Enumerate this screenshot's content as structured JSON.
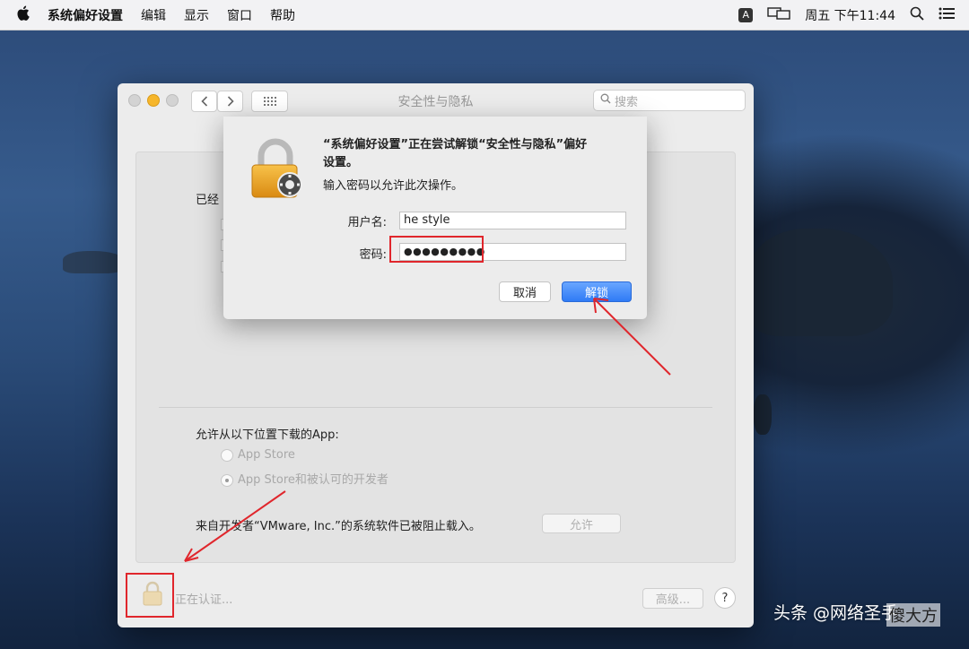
{
  "menubar": {
    "app_name": "系统偏好设置",
    "menus": [
      "编辑",
      "显示",
      "窗口",
      "帮助"
    ],
    "input_indicator": "A",
    "clock": "周五 下午11:44"
  },
  "window": {
    "title": "安全性与隐私",
    "search_placeholder": "搜索",
    "general_partial_label": "已经",
    "allow_apps_label": "允许从以下位置下载的App:",
    "radio_options": [
      "App Store",
      "App Store和被认可的开发者"
    ],
    "blocked_message": "来自开发者“VMware, Inc.”的系统软件已被阻止载入。",
    "allow_button": "允许",
    "lock_status": "正在认证...",
    "advanced_button": "高级...",
    "help_button": "?"
  },
  "dialog": {
    "message_line1": "“系统偏好设置”正在尝试解锁“安全性与隐私”偏好",
    "message_line2": "设置。",
    "sub_message": "输入密码以允许此次操作。",
    "username_label": "用户名:",
    "username_value": "he style",
    "password_label": "密码:",
    "password_value": "●●●●●●●●●",
    "cancel_button": "取消",
    "unlock_button": "解锁"
  },
  "watermark": {
    "prefix": "头条",
    "handle": "@网络圣手",
    "overlay": "傻大方"
  },
  "colors": {
    "accent": "#3478f6",
    "annotation_red": "#e0262c"
  }
}
